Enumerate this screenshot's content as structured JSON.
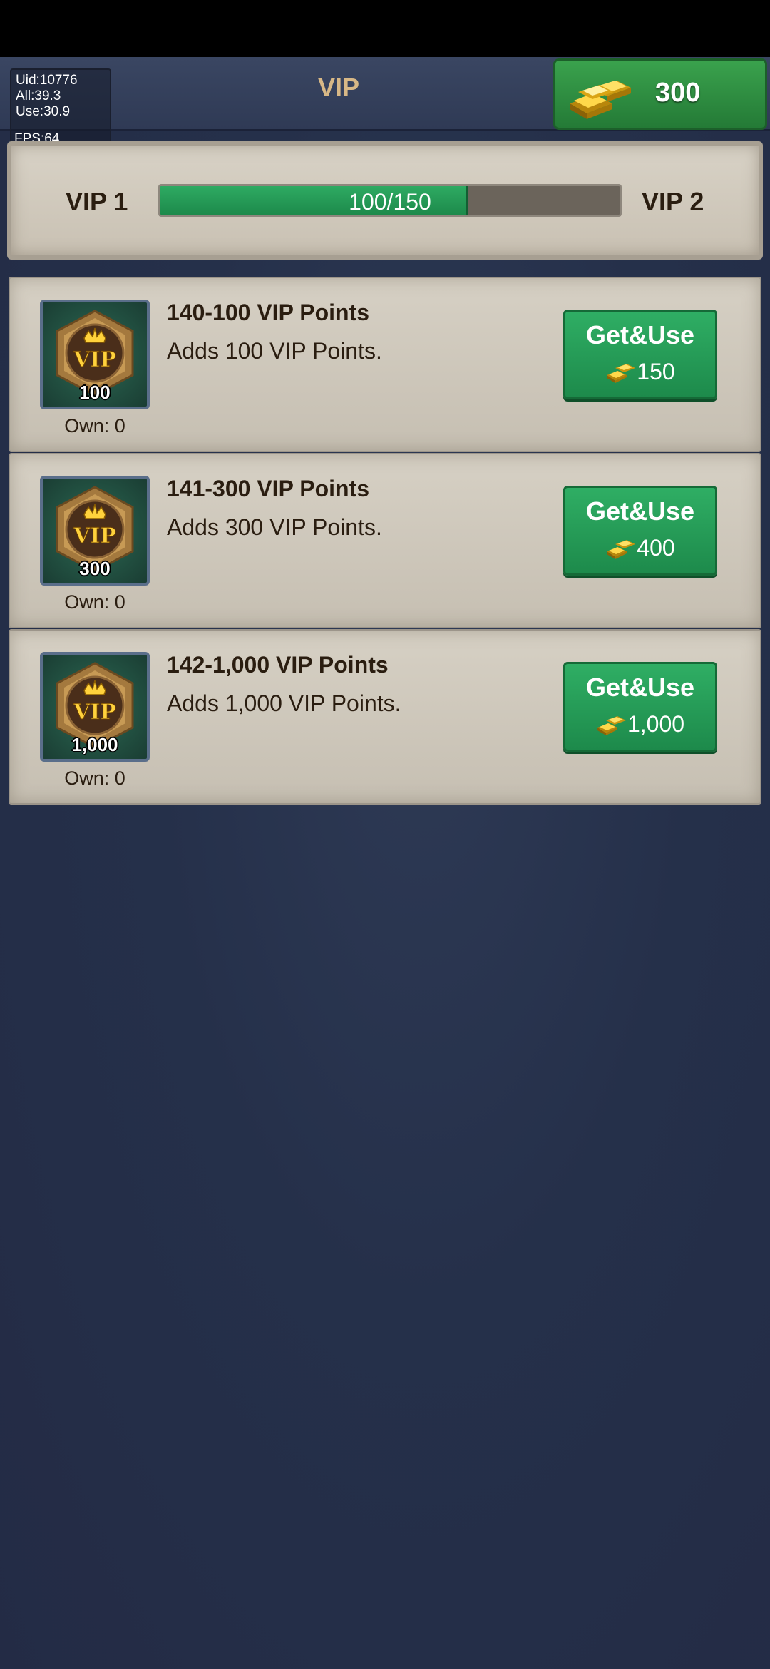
{
  "header": {
    "title": "VIP",
    "gold_amount": "300",
    "debug": {
      "uid": "Uid:10776",
      "all": "All:39.3",
      "use": "Use:30.9",
      "fps": "FPS:64"
    }
  },
  "vip_progress": {
    "current_level": "VIP 1",
    "next_level": "VIP 2",
    "progress_text": "100/150",
    "progress_fraction": 0.6667
  },
  "items": [
    {
      "title": "140-100 VIP Points",
      "description": "Adds 100 VIP Points.",
      "icon_count": "100",
      "own": "Own: 0",
      "button_label": "Get&Use",
      "price": "150"
    },
    {
      "title": "141-300 VIP Points",
      "description": "Adds 300 VIP Points.",
      "icon_count": "300",
      "own": "Own: 0",
      "button_label": "Get&Use",
      "price": "400"
    },
    {
      "title": "142-1,000 VIP Points",
      "description": "Adds 1,000 VIP Points.",
      "icon_count": "1,000",
      "own": "Own: 0",
      "button_label": "Get&Use",
      "price": "1,000"
    }
  ],
  "icons": {
    "gold": "gold-bars-icon",
    "vip_item": "vip-badge-icon"
  },
  "colors": {
    "accent_green": "#1d8a4b",
    "title_gold": "#d8b886",
    "background": "#25304a"
  }
}
